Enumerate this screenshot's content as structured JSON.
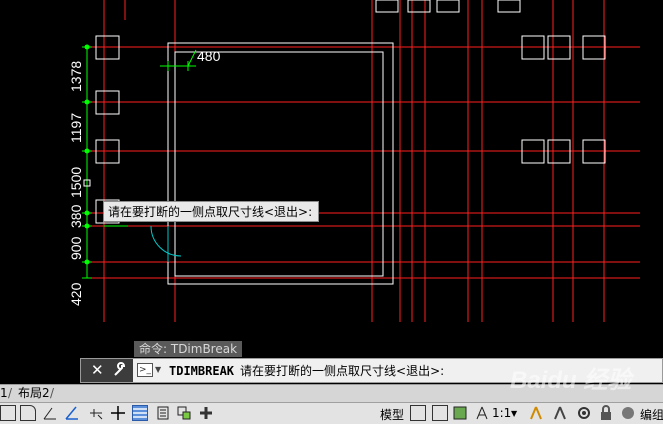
{
  "drawing": {
    "dimensions": [
      "1378",
      "1197",
      "1500",
      "380",
      "900",
      "420"
    ],
    "width_dim": "480"
  },
  "tooltip": "请在要打断的一侧点取尺寸线<退出>:",
  "command_history": "命令: TDimBreak",
  "command_line": {
    "command": "TDIMBREAK",
    "prompt": "请在要打断的一侧点取尺寸线<退出>:"
  },
  "layout_tabs": [
    "1",
    "布局2"
  ],
  "status": {
    "model_label": "模型",
    "scale": "1:1",
    "edit_label": "编组"
  },
  "watermark": "Baidu 经验",
  "colors": {
    "background": "#000000",
    "grid_red": "#ff2020",
    "dim_green": "#00ff00",
    "wall_white": "#ffffff",
    "door_cyan": "#00c8c8"
  }
}
